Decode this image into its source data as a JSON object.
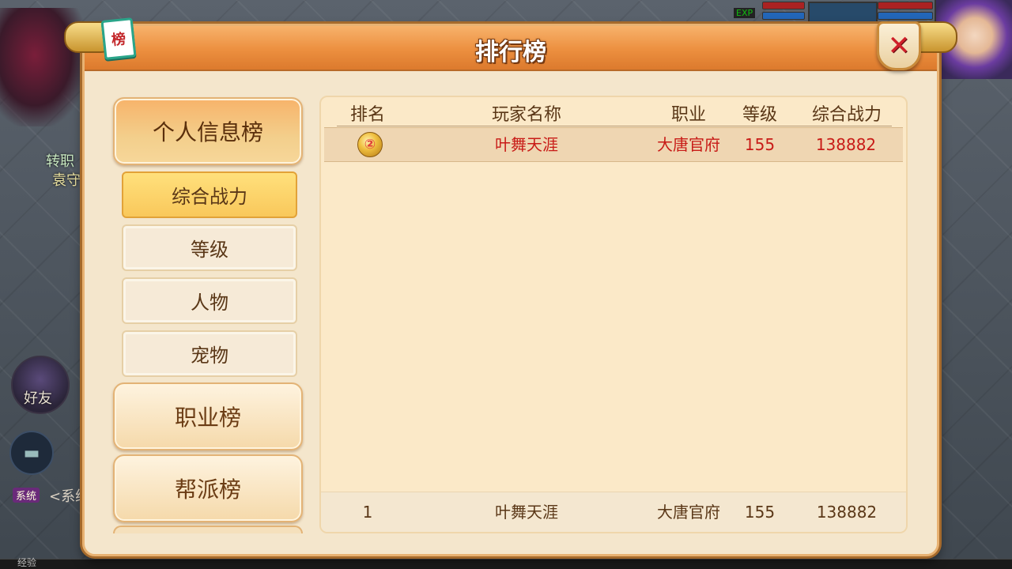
{
  "hud": {
    "exp_tag": "EXP",
    "friend_label": "好友",
    "system_tag": "系统",
    "system_text": "<系统",
    "left_text_1": "转职",
    "left_text_2": "袁守",
    "exp_label": "经验"
  },
  "window": {
    "title": "排行榜",
    "icon_char": "榜",
    "close_symbol": "✕"
  },
  "sidebar": {
    "main_tabs": [
      {
        "label": "个人信息榜",
        "active": true
      },
      {
        "label": "职业榜",
        "active": false
      },
      {
        "label": "帮派榜",
        "active": false
      }
    ],
    "sub_tabs": [
      {
        "label": "综合战力",
        "active": true
      },
      {
        "label": "等级",
        "active": false
      },
      {
        "label": "人物",
        "active": false
      },
      {
        "label": "宠物",
        "active": false
      }
    ]
  },
  "table": {
    "columns": [
      "排名",
      "玩家名称",
      "职业",
      "等级",
      "综合战力"
    ],
    "rows": [
      {
        "rank_icon": "2-medal-icon",
        "rank_glyph": "②",
        "name": "叶舞天涯",
        "job": "大唐官府",
        "level": "155",
        "power": "138882"
      }
    ],
    "self_row": {
      "rank": "1",
      "name": "叶舞天涯",
      "job": "大唐官府",
      "level": "155",
      "power": "138882"
    }
  },
  "colors": {
    "accent_orange": "#ec8f3f",
    "highlight_red": "#c81b17",
    "active_yellow": "#f9c85b"
  }
}
